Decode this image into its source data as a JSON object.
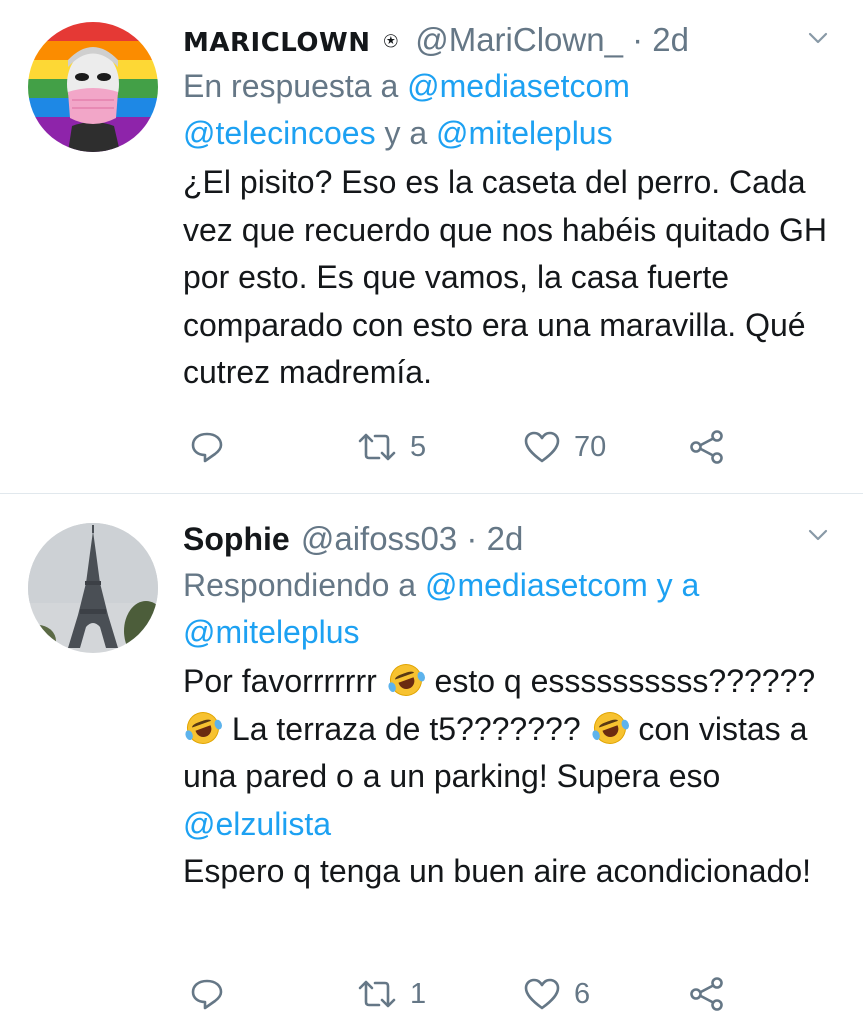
{
  "tweets": [
    {
      "name": "MARICLOWN",
      "badge": "⍟",
      "handle": "@MariClown_",
      "separator": " · ",
      "time": "2d",
      "reply_prefix": "En respuesta a ",
      "reply_link1": "@mediasetcom",
      "reply_link2": "@telecincoes",
      "reply_mid": " y a ",
      "reply_link3": "@miteleplus",
      "body": "¿El pisito? Eso es la caseta del perro. Cada vez que recuerdo que nos habéis quitado GH por esto. Es que vamos, la casa fuerte comparado con esto era una maravilla. Qué cutrez madremía.",
      "retweets": "5",
      "likes": "70"
    },
    {
      "name": "Sophie",
      "handle": "@aifoss03",
      "separator": " · ",
      "time": "2d",
      "reply_prefix": "Respondiendo a ",
      "reply_link1": "@mediasetcom",
      "reply_mid": " y a",
      "reply_link2": "@miteleplus",
      "body_1": "Por favorrrrrrr",
      "body_2": " esto q essssssssss??????",
      "body_3": " La terraza de t5???????",
      "body_4": " con vistas a una pared o a un parking! Supera eso ",
      "body_mention": "@elzulista",
      "body_5": "Espero q tenga un buen aire acondicionado!",
      "retweets": "1",
      "likes": "6"
    }
  ],
  "colors": {
    "link": "#1da1f2",
    "secondary_text": "#657786",
    "primary_text": "#14171a",
    "divider": "#e1e8ed"
  },
  "icons": {
    "reply": "reply-icon",
    "retweet": "retweet-icon",
    "like": "like-icon",
    "share": "share-icon",
    "more": "chevron-down-icon",
    "emoji": "rolling-on-floor-laughing-emoji"
  }
}
